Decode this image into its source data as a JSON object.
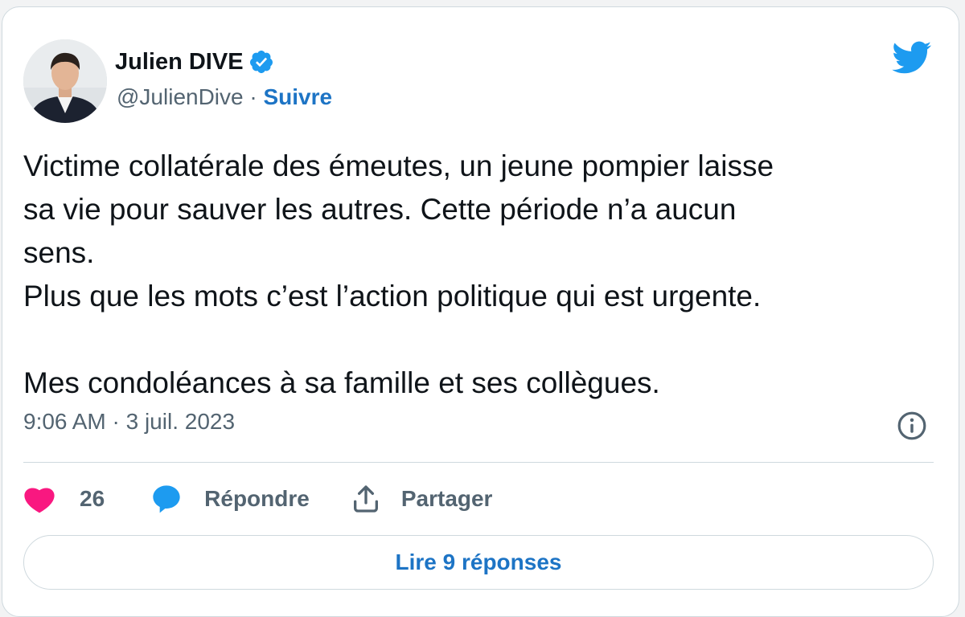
{
  "author": {
    "name": "Julien DIVE",
    "handle": "@JulienDive",
    "separator": " · ",
    "follow_label": "Suivre",
    "verified": true
  },
  "tweet": {
    "text": "Victime collatérale des émeutes, un jeune pompier laisse\nsa vie pour sauver les autres. Cette période n’a aucun\nsens.\nPlus que les mots c’est l’action politique qui est urgente.\n\nMes condoléances à sa famille et ses collègues.",
    "timestamp": "9:06 AM · 3 juil. 2023"
  },
  "actions": {
    "like_count": "26",
    "reply_label": "Répondre",
    "share_label": "Partager"
  },
  "footer": {
    "read_replies_label": "Lire 9 réponses"
  },
  "icons": {
    "verified": "verified-badge-icon",
    "bird": "twitter-bird-icon",
    "info": "info-icon",
    "like": "heart-icon",
    "reply": "speech-bubble-icon",
    "share": "share-upload-icon"
  },
  "colors": {
    "accent": "#1d9bf0",
    "link": "#1d74c5",
    "like": "#f91880",
    "text": "#0f1419",
    "muted": "#536471",
    "border": "#cfd9de"
  }
}
